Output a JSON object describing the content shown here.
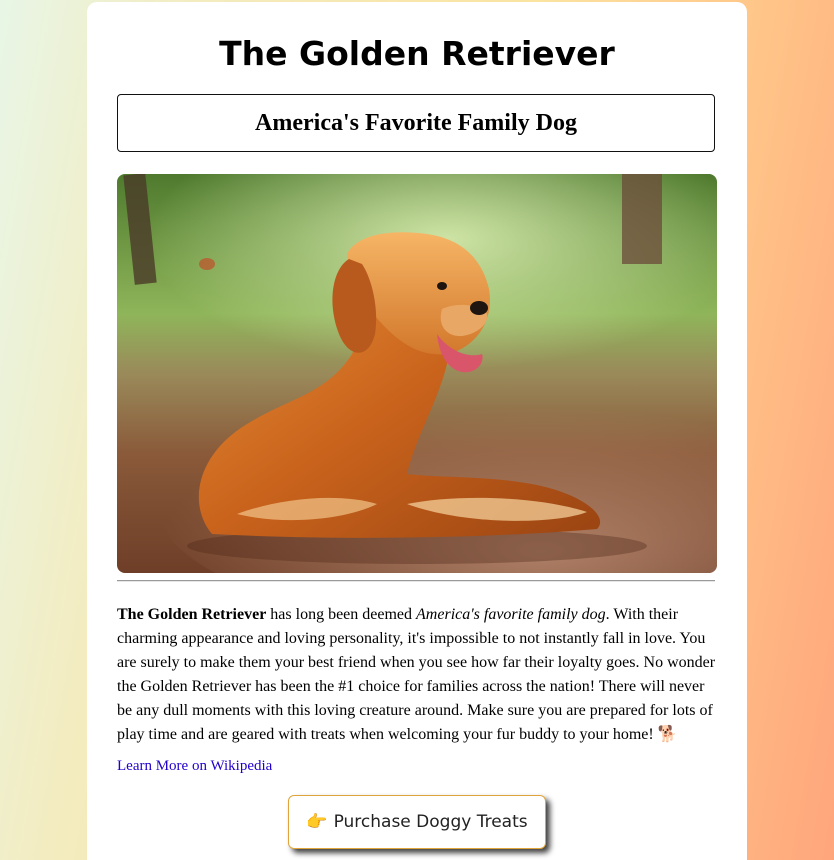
{
  "page": {
    "title": "The Golden Retriever",
    "subtitle": "America's Favorite Family Dog"
  },
  "image": {
    "subject": "golden retriever lying on a forest trail"
  },
  "body": {
    "bold_name": "The Golden Retriever",
    "text_1": " has long been deemed ",
    "italic_phrase": "America's favorite family dog",
    "text_2": ". With their charming appearance and loving personality, it's impossible to not instantly fall in love. You are surely to make them your best friend when you see how far their loyalty goes. No wonder the Golden Retriever has been the #1 choice for families across the nation! There will never be any dull moments with this loving creature around. Make sure you are prepared for lots of play time and are geared with treats when welcoming your fur buddy to your home! ",
    "dog_emoji": "🐕"
  },
  "link": {
    "label": "Learn More on Wikipedia"
  },
  "button": {
    "icon": "👉",
    "label": "Purchase Doggy Treats"
  },
  "colors": {
    "link": "#2200cc",
    "button_border": "#e0a53a"
  }
}
